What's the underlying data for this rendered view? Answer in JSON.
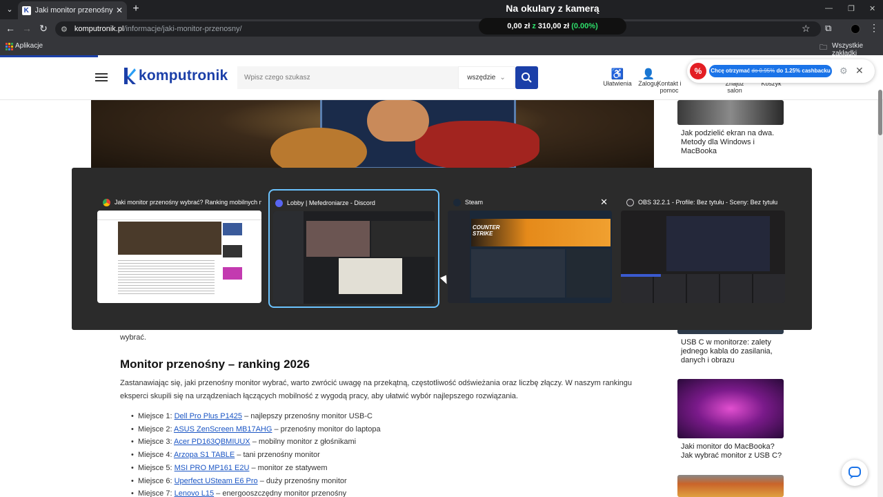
{
  "browser": {
    "tab_title": "Jaki monitor przenośny wybrać",
    "url_host": "komputronik.pl",
    "url_path": "/informacje/jaki-monitor-przenosny/",
    "bookmarks_apps": "Aplikacje",
    "bookmarks_all": "Wszystkie zakładki"
  },
  "overlay": {
    "title": "Na okulary z kamerą",
    "amount_current": "0,00 zł",
    "amount_sep": "z",
    "amount_goal": "310,00 zł",
    "amount_pct": "(0.00%)"
  },
  "site": {
    "logo_text": "komputronik",
    "search_placeholder": "Wpisz czego szukasz",
    "search_scope": "wszędzie",
    "header_links": [
      {
        "label": "Ułatwienia"
      },
      {
        "label": "Zaloguj"
      },
      {
        "label": "Kontakt i pomoc"
      },
      {
        "label": "Znajdź salon"
      },
      {
        "label": "Koszyk"
      }
    ]
  },
  "cashback": {
    "pre": "Chcę otrzymać",
    "old": "do 0.95%",
    "new": "do 1.25% cashbacku"
  },
  "switcher": {
    "windows": [
      {
        "title": "Jaki monitor przenośny wybrać? Ranking mobilnych m...",
        "app": "chrome"
      },
      {
        "title": "Lobby | Mefedroniarze - Discord",
        "app": "discord"
      },
      {
        "title": "Steam",
        "app": "steam",
        "thumb_text": "COUNTER STRIKE"
      },
      {
        "title": "OBS 32.2.1 - Profile: Bez tytułu - Sceny: Bez tytułu",
        "app": "obs"
      }
    ]
  },
  "article": {
    "fragment": "wybrać.",
    "heading": "Monitor przenośny – ranking 2026",
    "intro_line1": "Zastanawiając się, jaki przenośny monitor wybrać, warto zwrócić uwagę na przekątną, częstotliwość odświeżania oraz liczbę złączy. W naszym rankingu",
    "intro_line2": "eksperci skupili się na urządzeniach łączących mobilność z wygodą pracy, aby ułatwić wybór najlepszego rozwiązania.",
    "ranking": [
      {
        "place": "Miejsce 1:",
        "product": "Dell Pro Plus P1425",
        "desc": " – najlepszy przenośny monitor USB-C"
      },
      {
        "place": "Miejsce 2:",
        "product": "ASUS ZenScreen MB17AHG",
        "desc": " – przenośny monitor do laptopa"
      },
      {
        "place": "Miejsce 3:",
        "product": "Acer PD163QBMIUUX",
        "desc": " – mobilny monitor z głośnikami"
      },
      {
        "place": "Miejsce 4:",
        "product": "Arzopa S1 TABLE",
        "desc": " – tani przenośny monitor"
      },
      {
        "place": "Miejsce 5:",
        "product": "MSI PRO MP161 E2U",
        "desc": " – monitor ze statywem"
      },
      {
        "place": "Miejsce 6:",
        "product": "Uperfect USteam E6 Pro",
        "desc": " – duży przenośny monitor"
      },
      {
        "place": "Miejsce 7:",
        "product": "Lenovo L15",
        "desc": " – energooszczędny monitor przenośny"
      }
    ]
  },
  "sidebar": {
    "articles": [
      {
        "title": "Jak podzielić ekran na dwa. Metody dla Windows i MacBooka"
      },
      {
        "title": "USB C w monitorze: zalety jednego kabla do zasilania, danych i obrazu"
      },
      {
        "title": "Jaki monitor do MacBooka? Jak wybrać monitor z USB C?"
      }
    ]
  },
  "colors": {
    "brand": "#1b3fa8",
    "link": "#1a55c4",
    "selection": "#6bc3ff"
  }
}
